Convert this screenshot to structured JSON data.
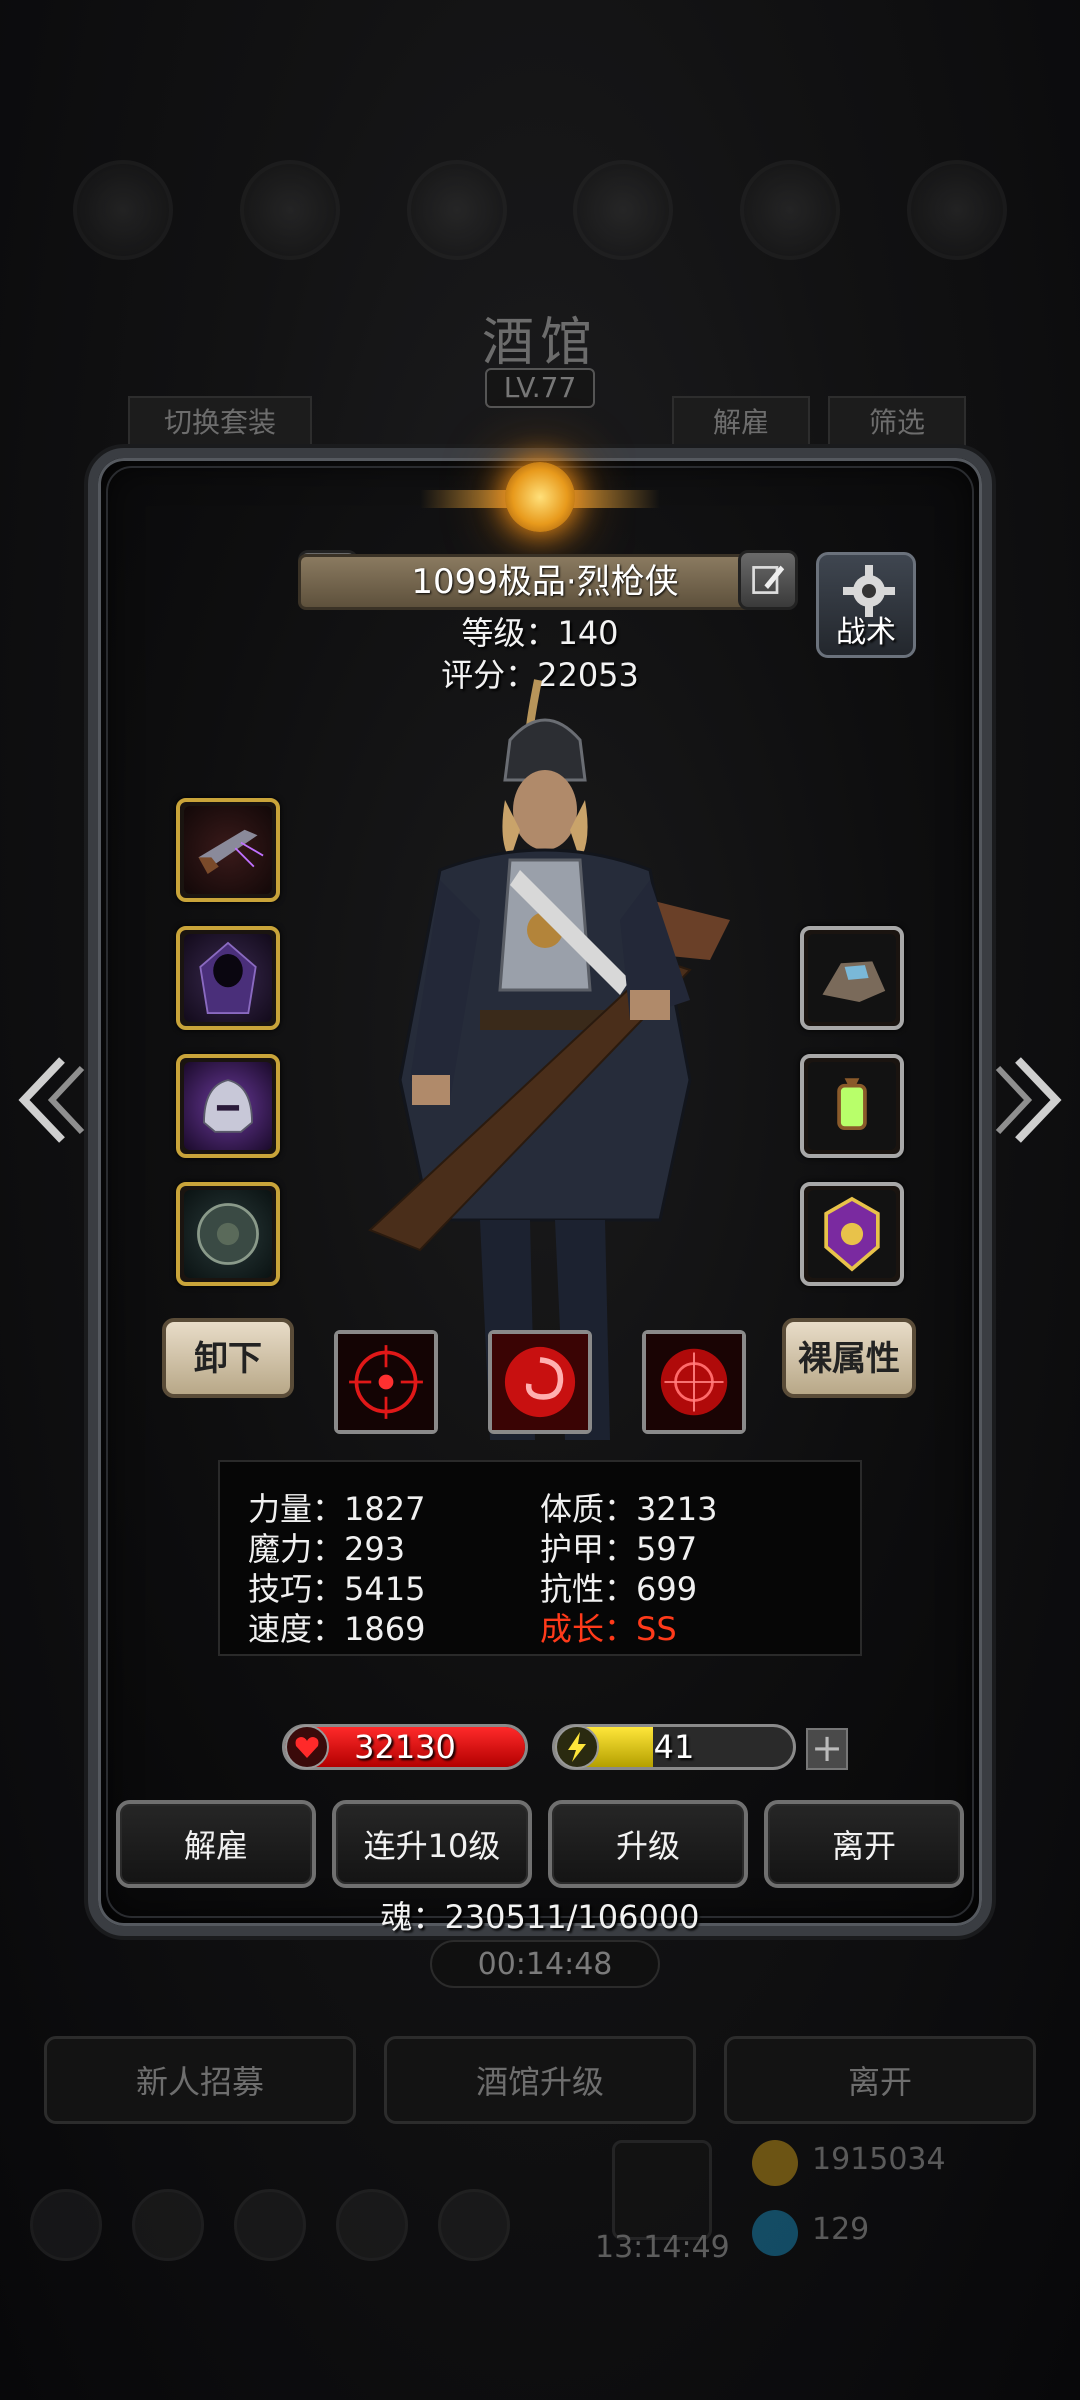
{
  "background": {
    "title": "酒馆",
    "level": "LV.77",
    "tab_switch_outfit": "切换套装",
    "tab_dismiss": "解雇",
    "tab_filter": "筛选",
    "timer": "00:14:48",
    "buttons": [
      "新人招募",
      "酒馆升级",
      "离开"
    ],
    "gift_time": "13:14:49",
    "gold": "1915034",
    "gems": "129"
  },
  "hero": {
    "name": "1099极品·烈枪侠",
    "level_text": "等级：140",
    "score_text": "评分：22053",
    "tactics_label": "战术"
  },
  "equipment": {
    "left": [
      "pistol-icon",
      "cloak-icon",
      "helmet-icon",
      "shield-icon"
    ],
    "right": [
      "ore-icon",
      "lantern-icon",
      "emblem-icon"
    ]
  },
  "actions": {
    "unequip": "卸下",
    "base_attrs": "裸属性"
  },
  "skills": [
    "crosshair-skill-icon",
    "vortex-skill-icon",
    "target-skill-icon"
  ],
  "attributes": {
    "strength": "力量：1827",
    "magic": "魔力：293",
    "skill": "技巧：5415",
    "speed": "速度：1869",
    "constitution": "体质：3213",
    "armor": "护甲：597",
    "resistance": "抗性：699",
    "growth": "成长：SS"
  },
  "bars": {
    "hp": "32130",
    "hp_fraction": 1.0,
    "energy": "41",
    "energy_fraction": 0.41,
    "plus": "+"
  },
  "buttons": {
    "dismiss": "解雇",
    "level_up_10": "连升10级",
    "level_up": "升级",
    "leave": "离开"
  },
  "soul": "魂：230511/106000",
  "colors": {
    "growth_red": "#ff3a1a",
    "hp_red": "#d90000",
    "energy_yellow": "#e0c800",
    "slot_gold": "#c9a43a"
  }
}
